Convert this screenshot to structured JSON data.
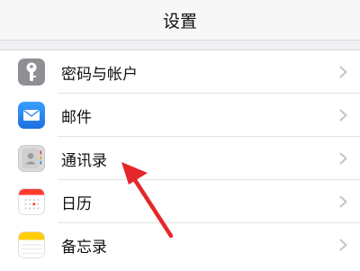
{
  "navbar": {
    "title": "设置"
  },
  "settings": [
    {
      "label": "密码与帐户",
      "icon": "key-icon",
      "color": "#8e8e93"
    },
    {
      "label": "邮件",
      "icon": "mail-icon",
      "color": "#2d8cf0"
    },
    {
      "label": "通讯录",
      "icon": "contacts-icon",
      "color": "#d8d8d8"
    },
    {
      "label": "日历",
      "icon": "calendar-icon",
      "color": "#ffffff"
    },
    {
      "label": "备忘录",
      "icon": "notes-icon",
      "color": "#ffffff"
    }
  ],
  "annotation": {
    "color": "#e5262b"
  }
}
